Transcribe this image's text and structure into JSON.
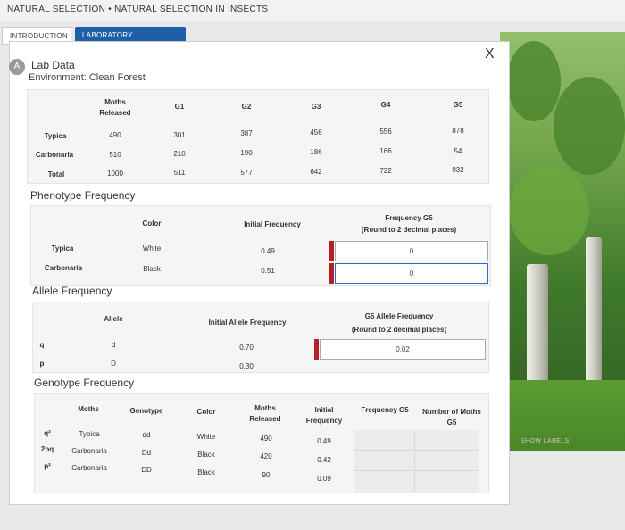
{
  "header": {
    "title": "NATURAL SELECTION • NATURAL SELECTION IN INSECTS"
  },
  "tabs": {
    "intro": "INTRODUCTION",
    "lab": "LABORATORY SIMULATION"
  },
  "panel": {
    "avatar": "A",
    "title": "Lab Data",
    "environment": "Environment: Clean Forest",
    "close": "X"
  },
  "moths_table": {
    "headers": [
      "Moths Released",
      "G1",
      "G2",
      "G3",
      "G4",
      "G5"
    ],
    "rows": [
      {
        "label": "Typica",
        "values": [
          "490",
          "301",
          "387",
          "456",
          "556",
          "878"
        ]
      },
      {
        "label": "Carbonaria",
        "values": [
          "510",
          "210",
          "190",
          "186",
          "166",
          "54"
        ]
      },
      {
        "label": "Total",
        "values": [
          "1000",
          "511",
          "577",
          "642",
          "722",
          "932"
        ]
      }
    ]
  },
  "phenotype": {
    "title": "Phenotype Frequency",
    "headers": [
      "Color",
      "Initial Frequency",
      "Frequency G5",
      "(Round to 2 decimal places)"
    ],
    "rows": [
      {
        "label": "Typica",
        "color": "White",
        "initial": "0.49",
        "input": "0"
      },
      {
        "label": "Carbonaria",
        "color": "Black",
        "initial": "0.51",
        "input": "0"
      }
    ]
  },
  "allele": {
    "title": "Allele Frequency",
    "headers": [
      "Allele",
      "Initial Allele Frequency",
      "G5 Allele Frequency",
      "(Round to 2 decimal places)"
    ],
    "rows": [
      {
        "sym": "q",
        "allele": "d",
        "initial": "0.70",
        "input": "0.02"
      },
      {
        "sym": "p",
        "allele": "D",
        "initial": "0.30"
      }
    ]
  },
  "genotype": {
    "title": "Genotype Frequency",
    "headers": [
      "Moths",
      "Genotype",
      "Color",
      "Moths Released",
      "Initial Frequency",
      "Frequency G5",
      "Number of Moths G5"
    ],
    "rows": [
      {
        "sym": "q²",
        "moth": "Typica",
        "genotype": "dd",
        "color": "White",
        "released": "490",
        "initial": "0.49"
      },
      {
        "sym": "2pq",
        "moth": "Carbonaria",
        "genotype": "Dd",
        "color": "Black",
        "released": "420",
        "initial": "0.42"
      },
      {
        "sym": "p²",
        "moth": "Carbonaria",
        "genotype": "DD",
        "color": "Black",
        "released": "90",
        "initial": "0.09"
      }
    ]
  },
  "scene": {
    "show_labels": "SHOW LABELS"
  },
  "colors": {
    "accent": "#1f5ea8",
    "marker": "#b82028",
    "active_border": "#2a6fc7"
  }
}
